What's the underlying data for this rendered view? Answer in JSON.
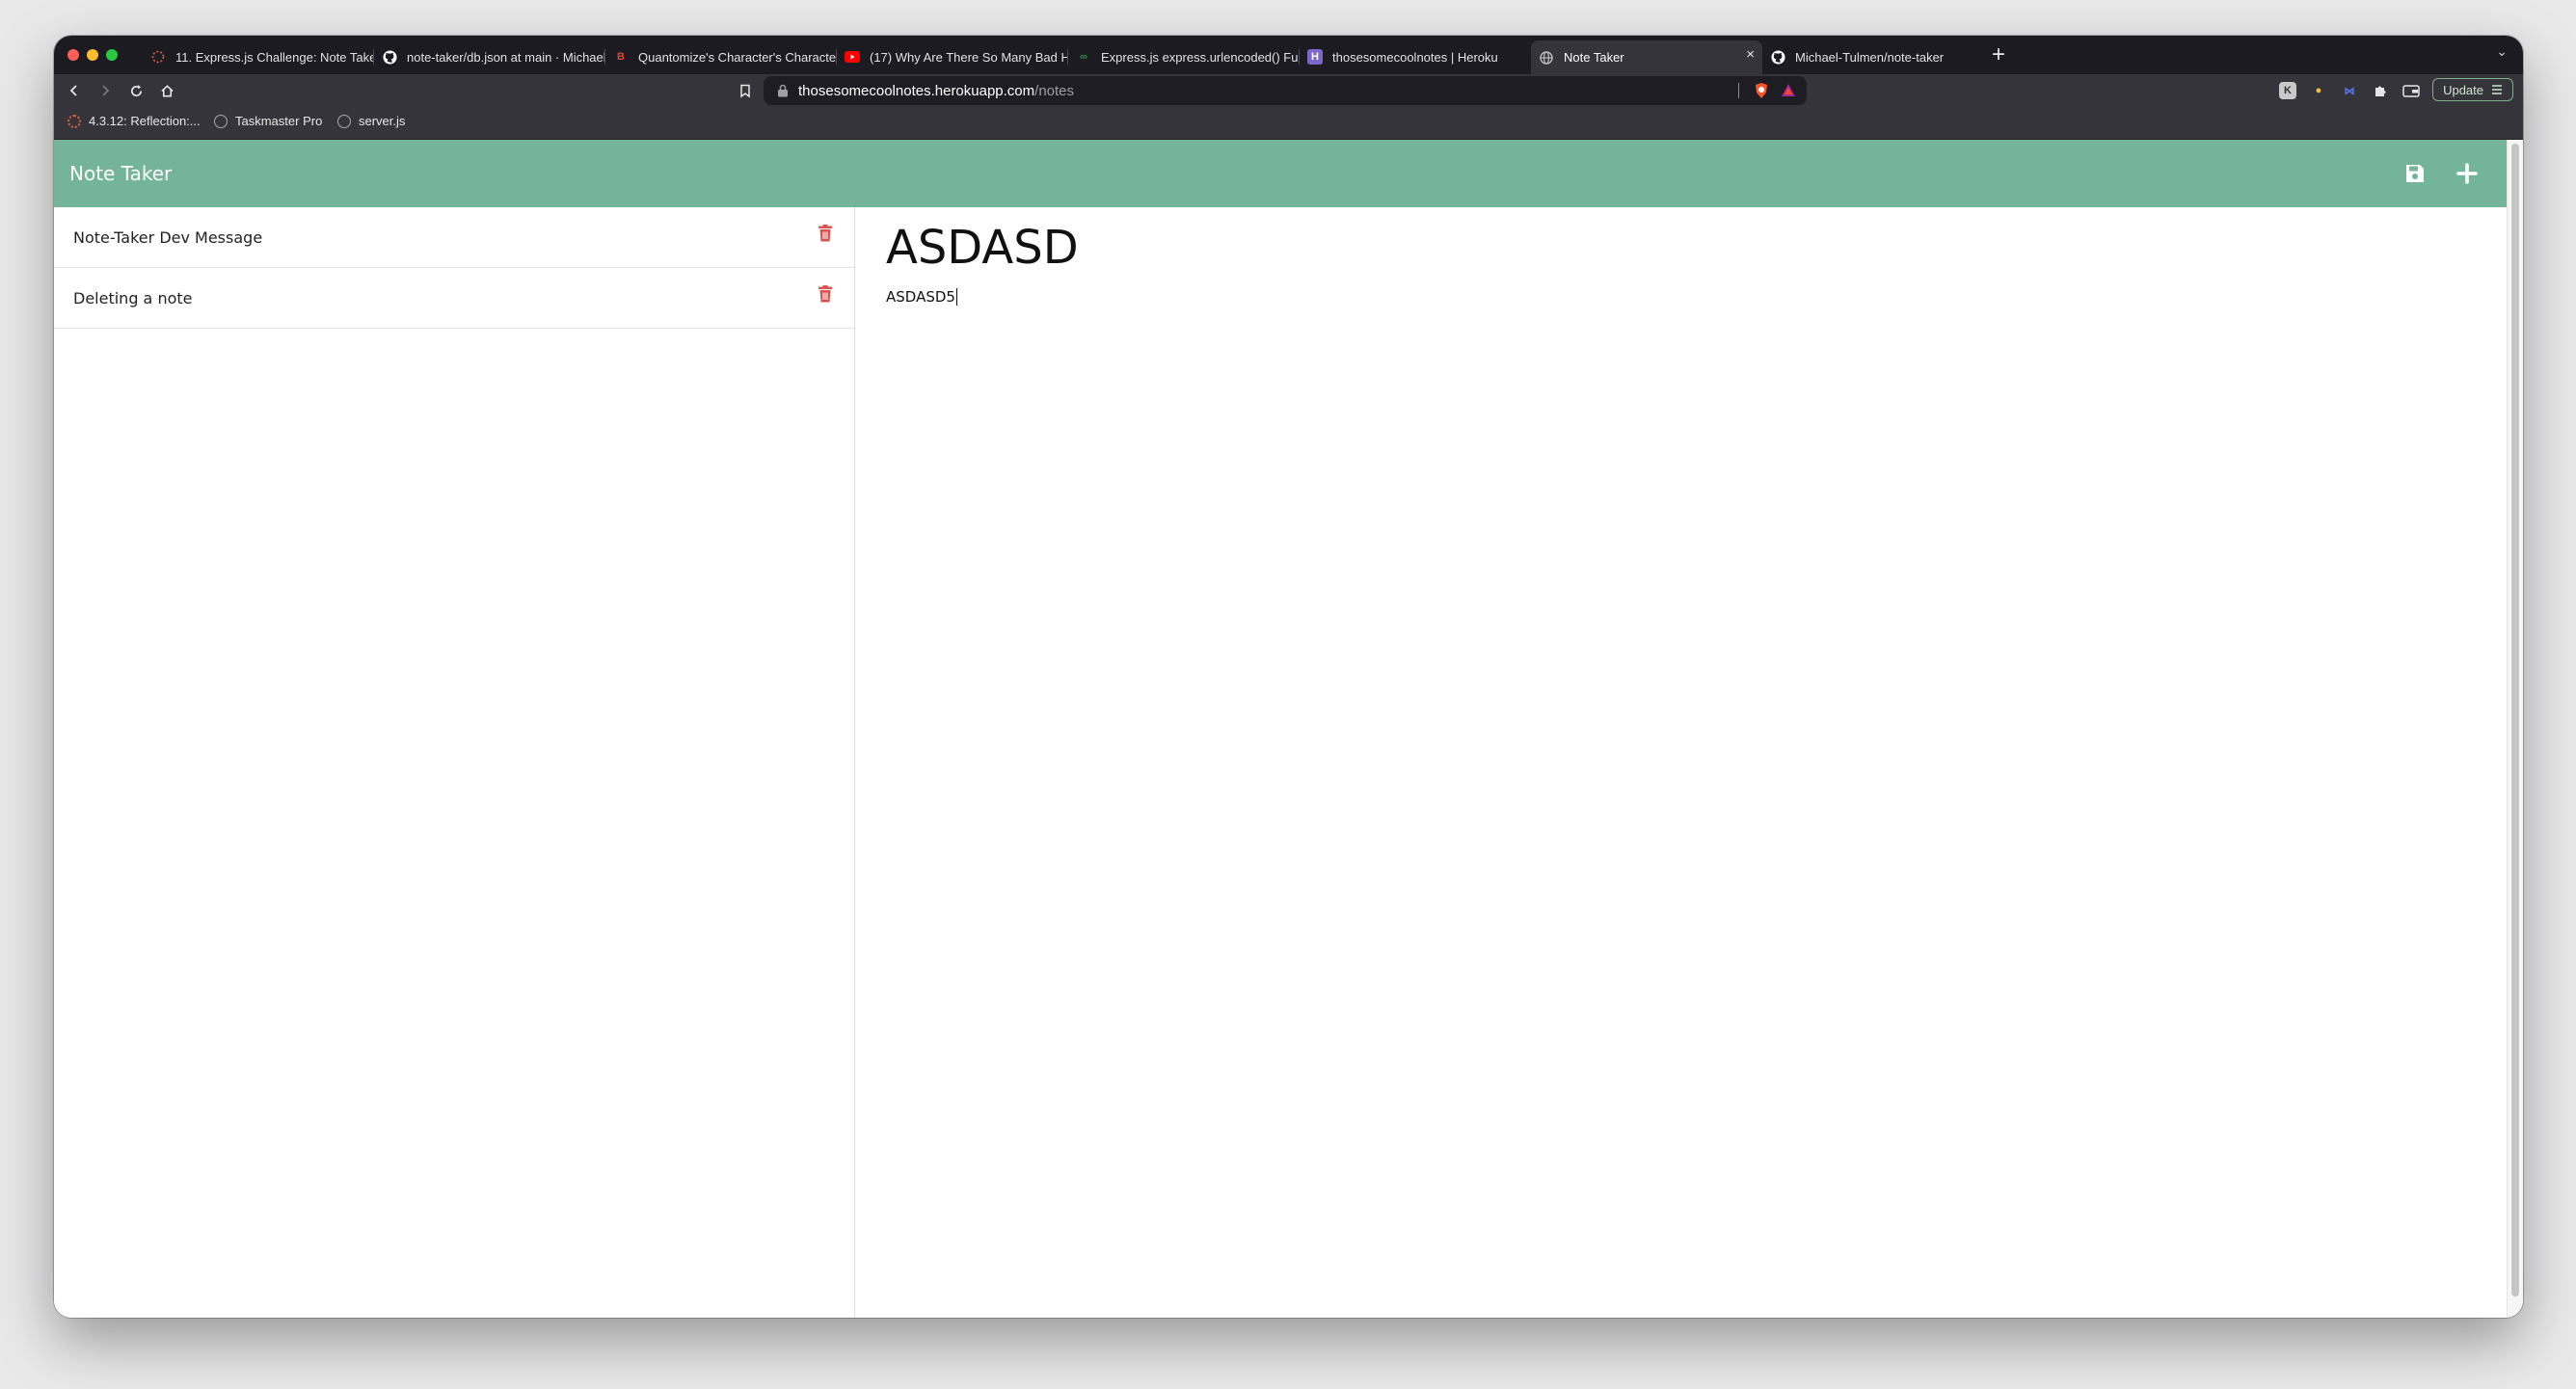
{
  "browser": {
    "tabs": [
      {
        "label": "11. Express.js Challenge: Note Taker",
        "icon": "loading-dots-icon",
        "color": "#e0603a"
      },
      {
        "label": "note-taker/db.json at main · Michael",
        "icon": "github-icon",
        "color": "#ffffff"
      },
      {
        "label": "Quantomize's Character's Characte",
        "icon": "b-letter-icon",
        "color": "#e0432f"
      },
      {
        "label": "(17) Why Are There So Many Bad H",
        "icon": "youtube-icon",
        "color": "#ff0000"
      },
      {
        "label": "Express.js express.urlencoded() Fu",
        "icon": "gfg-icon",
        "color": "#2f8d46"
      },
      {
        "label": "thosesomecoolnotes | Heroku",
        "icon": "heroku-icon",
        "color": "#7d67c7"
      },
      {
        "label": "Note Taker",
        "icon": "globe-icon",
        "color": "#bcbcbc",
        "active": true
      },
      {
        "label": "Michael-Tulmen/note-taker",
        "icon": "github-icon",
        "color": "#ffffff"
      }
    ],
    "tab_close": "×",
    "new_tab": "+",
    "tab_list": "⌄",
    "url": {
      "host": "thosesomecoolnotes.herokuapp.com",
      "path": "/notes"
    },
    "update_label": "Update",
    "bookmarks": [
      {
        "label": "4.3.12: Reflection:...",
        "icon": "loading-dots-icon"
      },
      {
        "label": "Taskmaster Pro",
        "icon": "globe-icon"
      },
      {
        "label": "server.js",
        "icon": "globe-icon"
      }
    ]
  },
  "app": {
    "brand": "Note Taker",
    "accent": "#74b49b",
    "trash_color": "#d9534f",
    "notes": [
      {
        "title": "Note-Taker Dev Message"
      },
      {
        "title": "Deleting a note"
      }
    ],
    "active_note": {
      "title": "ASDASD",
      "text": "ASDASD5"
    }
  }
}
